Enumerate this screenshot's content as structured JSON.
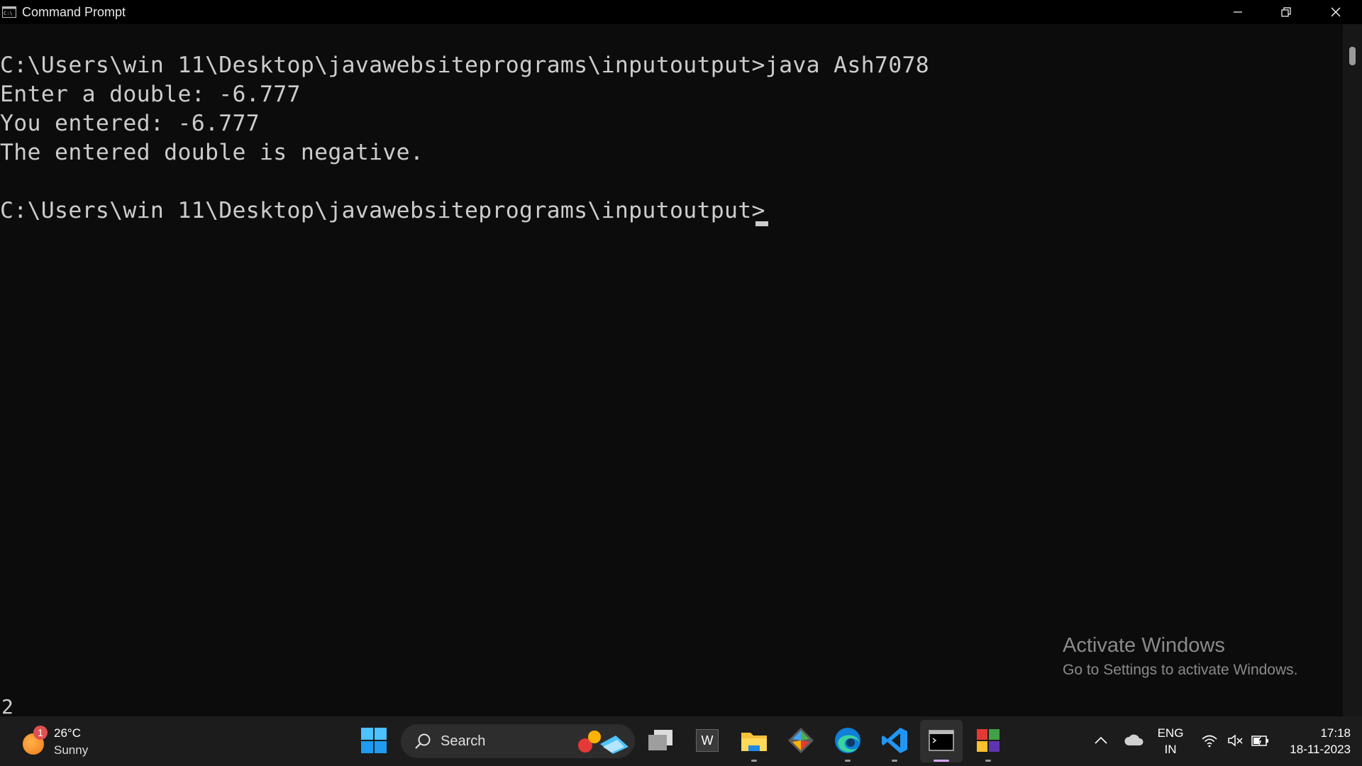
{
  "window": {
    "title": "Command Prompt"
  },
  "console": {
    "lines": [
      "C:\\Users\\win 11\\Desktop\\javawebsiteprograms\\inputoutput>java Ash7078",
      "Enter a double: -6.777",
      "You entered: -6.777",
      "The entered double is negative.",
      "",
      "C:\\Users\\win 11\\Desktop\\javawebsiteprograms\\inputoutput>"
    ]
  },
  "watermark": {
    "line1": "Activate Windows",
    "line2": "Go to Settings to activate Windows."
  },
  "stray_text": "2",
  "taskbar": {
    "weather": {
      "badge": "1",
      "temperature": "26°C",
      "condition": "Sunny"
    },
    "search_placeholder": "Search",
    "word_letter": "W",
    "tray": {
      "lang1": "ENG",
      "lang2": "IN",
      "time": "17:18",
      "date": "18-11-2023"
    }
  },
  "colors": {
    "console_bg": "#0c0c0c",
    "console_text": "#cccccc",
    "taskbar_bg": "#1c1c1c"
  }
}
